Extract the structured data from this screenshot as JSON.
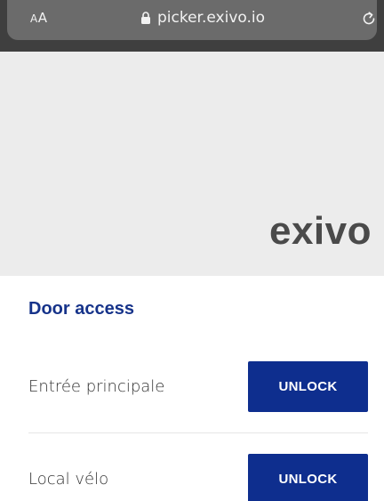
{
  "browser": {
    "text_size_large": "A",
    "text_size_small": "A",
    "url": "picker.exivo.io",
    "icons": {
      "lock": "lock-icon",
      "reload": "reload-icon"
    }
  },
  "banner": {
    "logo_text": "exivo",
    "background": "#ececec"
  },
  "main": {
    "title": "Door access",
    "doors": [
      {
        "name": "Entrée principale",
        "action": "UNLOCK"
      },
      {
        "name": "Local vélo",
        "action": "UNLOCK"
      }
    ]
  },
  "colors": {
    "accent": "#0e2e8e",
    "title": "#16338a",
    "toolbar": "#3f3f3f"
  }
}
